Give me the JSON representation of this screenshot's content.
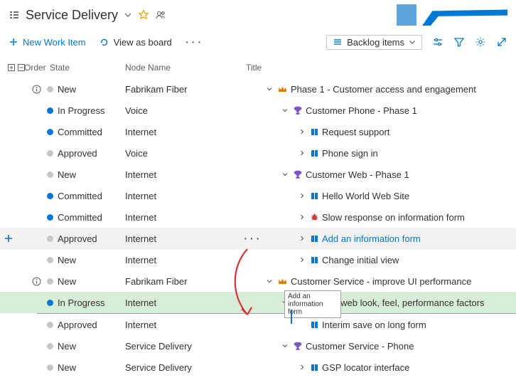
{
  "header": {
    "title": "Service Delivery"
  },
  "toolbar": {
    "newWorkItem": "New Work Item",
    "viewAsBoard": "View as board",
    "backlogItems": "Backlog items"
  },
  "columns": {
    "order": "Order",
    "state": "State",
    "node": "Node Name",
    "title": "Title"
  },
  "rows": [
    {
      "info": true,
      "stateColor": "grey",
      "state": "New",
      "node": "Fabrikam Fiber",
      "indent": 0,
      "chev": "down",
      "icon": "crown",
      "title": "Phase 1 - Customer access and engagement"
    },
    {
      "stateColor": "blue",
      "state": "In Progress",
      "node": "Voice",
      "indent": 1,
      "chev": "down",
      "icon": "trophy",
      "title": "Customer Phone - Phase 1"
    },
    {
      "stateColor": "blue",
      "state": "Committed",
      "node": "Internet",
      "indent": 2,
      "chev": "right",
      "icon": "pbi",
      "title": "Request support"
    },
    {
      "stateColor": "grey",
      "state": "Approved",
      "node": "Voice",
      "indent": 2,
      "chev": "right",
      "icon": "pbi",
      "title": "Phone sign in"
    },
    {
      "stateColor": "grey",
      "state": "New",
      "node": "Internet",
      "indent": 1,
      "chev": "down",
      "icon": "trophy",
      "title": "Customer Web - Phase 1"
    },
    {
      "stateColor": "blue",
      "state": "Committed",
      "node": "Internet",
      "indent": 2,
      "chev": "right",
      "icon": "pbi",
      "title": "Hello World Web Site"
    },
    {
      "stateColor": "blue",
      "state": "Committed",
      "node": "Internet",
      "indent": 2,
      "chev": "right",
      "icon": "bug",
      "title": "Slow response on information form"
    },
    {
      "plus": true,
      "highlight": true,
      "actions": true,
      "stateColor": "grey",
      "state": "Approved",
      "node": "Internet",
      "indent": 2,
      "chev": "right",
      "icon": "pbi",
      "title": "Add an information form",
      "link": true
    },
    {
      "stateColor": "grey",
      "state": "New",
      "node": "Internet",
      "indent": 2,
      "chev": "right",
      "icon": "pbi",
      "title": "Change initial view"
    },
    {
      "info": true,
      "stateColor": "grey",
      "state": "New",
      "node": "Fabrikam Fiber",
      "indent": 0,
      "chev": "down",
      "icon": "crown",
      "title": "Customer Service - improve UI performance",
      "masked": "Cust"
    },
    {
      "green": true,
      "stateColor": "blue",
      "state": "In Progress",
      "node": "Internet",
      "indent": 1,
      "chev": "down",
      "icon": "trophy",
      "title": "Refresh web look, feel, performance factors"
    },
    {
      "stateColor": "grey",
      "state": "Approved",
      "node": "Internet",
      "indent": 2,
      "chev": "",
      "icon": "pbi",
      "title": "Interim save on long form"
    },
    {
      "stateColor": "grey",
      "state": "New",
      "node": "Service Delivery",
      "indent": 1,
      "chev": "down",
      "icon": "trophy",
      "title": "Customer Service - Phone"
    },
    {
      "stateColor": "grey",
      "state": "New",
      "node": "Service Delivery",
      "indent": 2,
      "chev": "right",
      "icon": "pbi",
      "title": "GSP locator interface"
    }
  ],
  "tooltip": {
    "line1": "Add an",
    "line2": "information form"
  }
}
